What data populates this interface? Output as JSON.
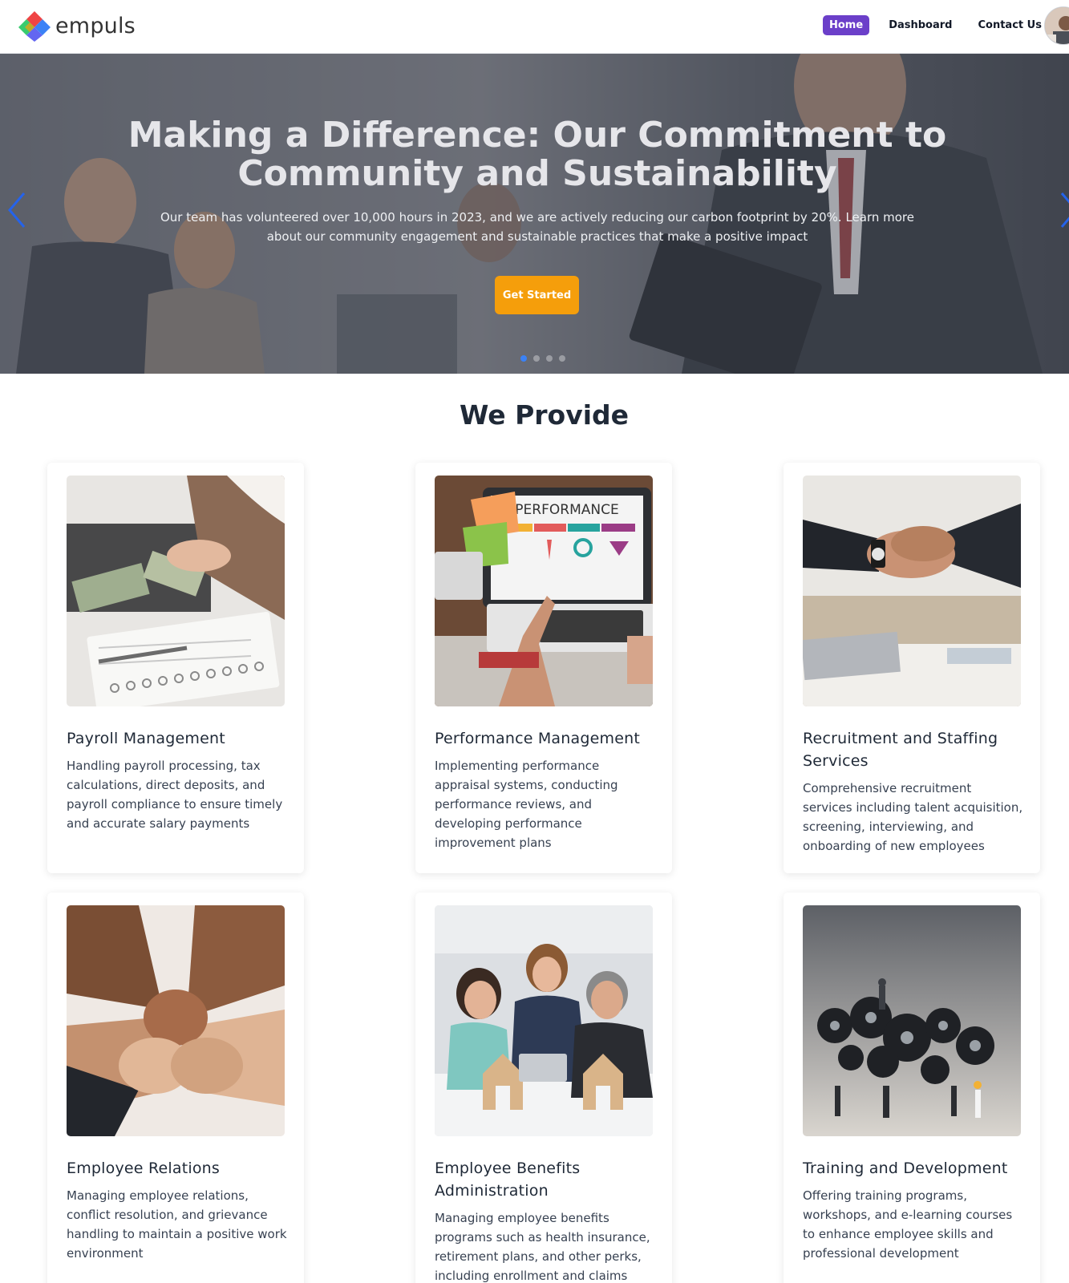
{
  "brand": {
    "name": "empuls"
  },
  "nav": {
    "home": "Home",
    "dashboard": "Dashboard",
    "contact": "Contact Us"
  },
  "hero": {
    "title": "Making a Difference: Our Commitment to Community and Sustainability",
    "subtitle": "Our team has volunteered over 10,000 hours in 2023, and we are actively reducing our carbon footprint by 20%. Learn more about our community engagement and sustainable practices that make a positive impact",
    "button": "Get Started",
    "slides_total": 4,
    "active_slide": 1
  },
  "section": {
    "title": "We Provide"
  },
  "cards": [
    {
      "title": "Payroll Management",
      "desc": "Handling payroll processing, tax calculations, direct deposits, and payroll compliance to ensure timely and accurate salary payments"
    },
    {
      "title": "Performance Management",
      "desc": "Implementing performance appraisal systems, conducting performance reviews, and developing performance improvement plans",
      "image_text": "PERFORMANCE"
    },
    {
      "title": "Recruitment and Staffing Services",
      "desc": "Comprehensive recruitment services including talent acquisition, screening, interviewing, and onboarding of new employees"
    },
    {
      "title": "Employee Relations",
      "desc": "Managing employee relations, conflict resolution, and grievance handling to maintain a positive work environment"
    },
    {
      "title": "Employee Benefits Administration",
      "desc": "Managing employee benefits programs such as health insurance, retirement plans, and other perks, including enrollment and claims"
    },
    {
      "title": "Training and Development",
      "desc": "Offering training programs, workshops, and e-learning courses to enhance employee skills and professional development"
    }
  ],
  "colors": {
    "accent": "#6b3fc9",
    "cta": "#f59e0b",
    "carousel_active": "#3b82f6"
  }
}
